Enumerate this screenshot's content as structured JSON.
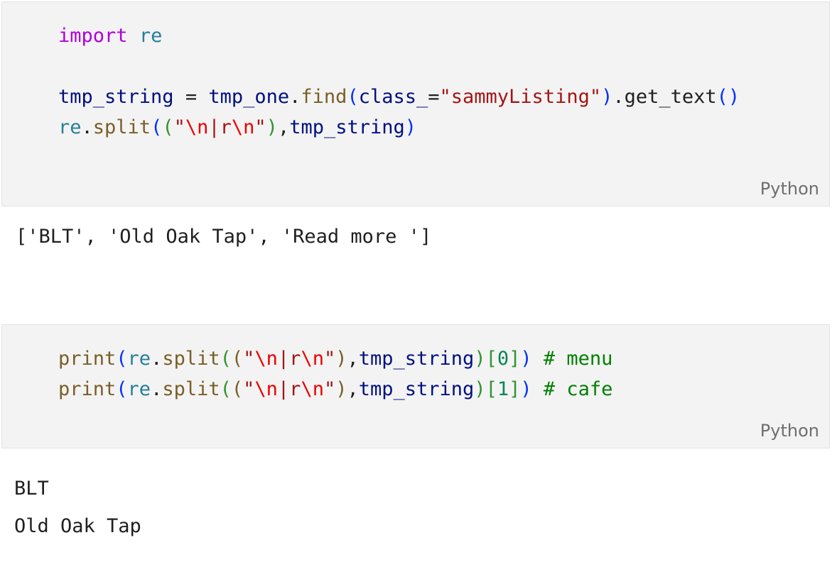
{
  "cells": [
    {
      "language_label": "Python",
      "code_lines": [
        [
          {
            "t": "import",
            "c": "kw"
          },
          {
            "t": " ",
            "c": "op"
          },
          {
            "t": "re",
            "c": "mod"
          }
        ],
        [],
        [
          {
            "t": "tmp_string",
            "c": "var"
          },
          {
            "t": " = ",
            "c": "op"
          },
          {
            "t": "tmp_one",
            "c": "var"
          },
          {
            "t": ".",
            "c": "op"
          },
          {
            "t": "find",
            "c": "fn"
          },
          {
            "t": "(",
            "c": "p1"
          },
          {
            "t": "class_",
            "c": "var"
          },
          {
            "t": "=",
            "c": "op"
          },
          {
            "t": "\"sammyListing\"",
            "c": "str"
          },
          {
            "t": ")",
            "c": "p1"
          },
          {
            "t": ".",
            "c": "op"
          },
          {
            "t": "get_text",
            "c": "op"
          },
          {
            "t": "()",
            "c": "p1"
          }
        ],
        [
          {
            "t": "re",
            "c": "mod"
          },
          {
            "t": ".",
            "c": "op"
          },
          {
            "t": "split",
            "c": "fn"
          },
          {
            "t": "(",
            "c": "p1"
          },
          {
            "t": "(",
            "c": "p2"
          },
          {
            "t": "\"",
            "c": "str"
          },
          {
            "t": "\\n",
            "c": "esc"
          },
          {
            "t": "|r",
            "c": "str"
          },
          {
            "t": "\\n",
            "c": "esc"
          },
          {
            "t": "\"",
            "c": "str"
          },
          {
            "t": ")",
            "c": "p2"
          },
          {
            "t": ",",
            "c": "op"
          },
          {
            "t": "tmp_string",
            "c": "var"
          },
          {
            "t": ")",
            "c": "p1"
          }
        ]
      ],
      "output_lines": [
        "['BLT', 'Old Oak Tap', 'Read more ']"
      ]
    },
    {
      "language_label": "Python",
      "code_lines": [
        [
          {
            "t": "print",
            "c": "fn"
          },
          {
            "t": "(",
            "c": "p1"
          },
          {
            "t": "re",
            "c": "mod"
          },
          {
            "t": ".",
            "c": "op"
          },
          {
            "t": "split",
            "c": "fn"
          },
          {
            "t": "(",
            "c": "p2"
          },
          {
            "t": "(",
            "c": "fn"
          },
          {
            "t": "\"",
            "c": "str"
          },
          {
            "t": "\\n",
            "c": "esc"
          },
          {
            "t": "|r",
            "c": "str"
          },
          {
            "t": "\\n",
            "c": "esc"
          },
          {
            "t": "\"",
            "c": "str"
          },
          {
            "t": ")",
            "c": "fn"
          },
          {
            "t": ",",
            "c": "op"
          },
          {
            "t": "tmp_string",
            "c": "var"
          },
          {
            "t": ")",
            "c": "p2"
          },
          {
            "t": "[",
            "c": "p2"
          },
          {
            "t": "0",
            "c": "num"
          },
          {
            "t": "]",
            "c": "p2"
          },
          {
            "t": ")",
            "c": "p1"
          },
          {
            "t": " ",
            "c": "op"
          },
          {
            "t": "# menu",
            "c": "cmt"
          }
        ],
        [
          {
            "t": "print",
            "c": "fn"
          },
          {
            "t": "(",
            "c": "p1"
          },
          {
            "t": "re",
            "c": "mod"
          },
          {
            "t": ".",
            "c": "op"
          },
          {
            "t": "split",
            "c": "fn"
          },
          {
            "t": "(",
            "c": "p2"
          },
          {
            "t": "(",
            "c": "fn"
          },
          {
            "t": "\"",
            "c": "str"
          },
          {
            "t": "\\n",
            "c": "esc"
          },
          {
            "t": "|r",
            "c": "str"
          },
          {
            "t": "\\n",
            "c": "esc"
          },
          {
            "t": "\"",
            "c": "str"
          },
          {
            "t": ")",
            "c": "fn"
          },
          {
            "t": ",",
            "c": "op"
          },
          {
            "t": "tmp_string",
            "c": "var"
          },
          {
            "t": ")",
            "c": "p2"
          },
          {
            "t": "[",
            "c": "p2"
          },
          {
            "t": "1",
            "c": "num"
          },
          {
            "t": "]",
            "c": "p2"
          },
          {
            "t": ")",
            "c": "p1"
          },
          {
            "t": " ",
            "c": "op"
          },
          {
            "t": "# cafe",
            "c": "cmt"
          }
        ]
      ],
      "output_lines": [
        "BLT",
        "Old Oak Tap"
      ]
    }
  ]
}
